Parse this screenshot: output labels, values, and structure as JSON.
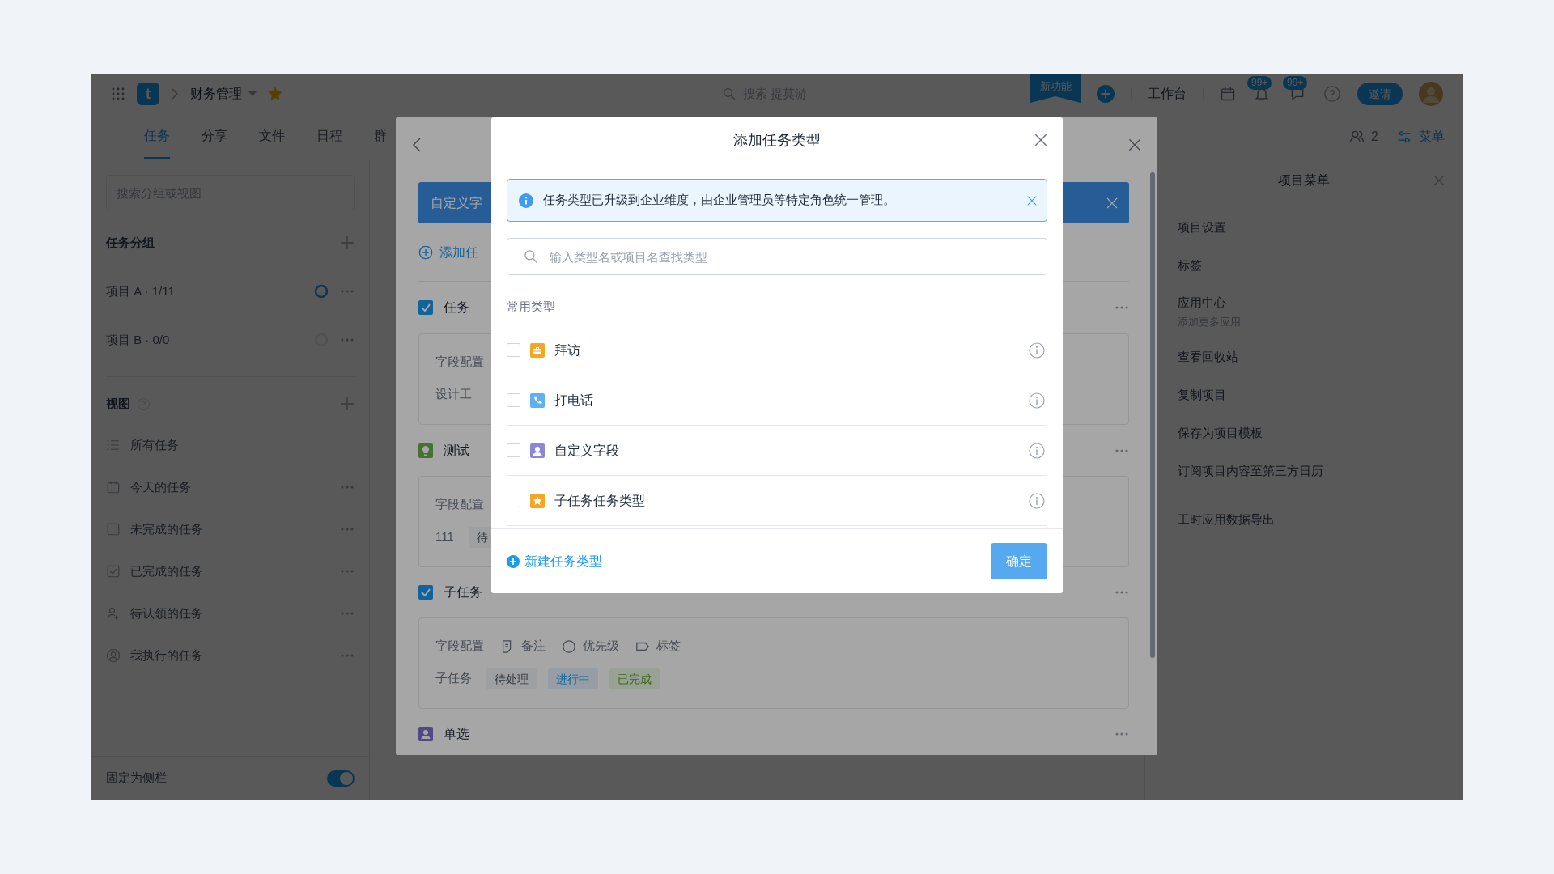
{
  "top_bar": {
    "logo": "t",
    "project": "财务管理",
    "starred": true,
    "search_placeholder": "搜索 提莫游",
    "new_feature": "新功能",
    "workbench": "工作台",
    "notifications": "99+",
    "messages": "99+",
    "invite": "邀请"
  },
  "tabs": [
    {
      "label": "任务",
      "selected": true
    },
    {
      "label": "分享",
      "selected": false
    },
    {
      "label": "文件",
      "selected": false
    },
    {
      "label": "日程",
      "selected": false
    },
    {
      "label": "群",
      "selected": false
    }
  ],
  "members": "2",
  "menu_button": "菜单",
  "sidebar": {
    "search_placeholder": "搜索分组或视图",
    "groups_title": "任务分组",
    "groups": [
      {
        "label": "项目 A · 1/11",
        "kind": "progress"
      },
      {
        "label": "项目 B · 0/0",
        "kind": "empty"
      }
    ],
    "views_title": "视图",
    "views": [
      {
        "label": "所有任务",
        "kind": "list",
        "more": false
      },
      {
        "label": "今天的任务",
        "kind": "calendar",
        "more": true
      },
      {
        "label": "未完成的任务",
        "kind": "square",
        "more": true
      },
      {
        "label": "已完成的任务",
        "kind": "checked",
        "more": true
      },
      {
        "label": "待认领的任务",
        "kind": "user-plus",
        "more": true
      },
      {
        "label": "我执行的任务",
        "kind": "user-circle",
        "more": true
      }
    ],
    "pin_label": "固定为侧栏",
    "pinned": true
  },
  "project_menu": {
    "title": "项目菜单",
    "items": [
      {
        "label": "项目设置"
      },
      {
        "label": "标签"
      },
      {
        "label": "应用中心",
        "note": "添加更多应用"
      },
      {
        "label": "查看回收站"
      },
      {
        "label": "复制项目"
      },
      {
        "label": "保存为项目模板"
      },
      {
        "label": "订阅项目内容至第三方日历"
      },
      {
        "label": "工时应用数据导出"
      }
    ]
  },
  "panel": {
    "banner": "自定义字",
    "add_label": "添加任",
    "types": [
      {
        "label": "任务",
        "kind": "checkbox",
        "card": {
          "field_label": "字段配置",
          "status_label": "设计工"
        }
      },
      {
        "label": "测试",
        "kind": "bulb",
        "card": {
          "field_label": "字段配置",
          "status_label": "111",
          "statuses": [
            {
              "label": "待",
              "kind": "todo"
            }
          ]
        }
      },
      {
        "label": "子任务",
        "kind": "checkbox",
        "card": {
          "field_label": "字段配置",
          "fields": [
            {
              "label": "备注",
              "kind": "note"
            },
            {
              "label": "优先级",
              "kind": "circle"
            },
            {
              "label": "标签",
              "kind": "tag"
            }
          ],
          "status_label": "子任务",
          "statuses": [
            {
              "label": "待处理",
              "kind": "todo"
            },
            {
              "label": "进行中",
              "kind": "doing"
            },
            {
              "label": "已完成",
              "kind": "done"
            }
          ]
        }
      },
      {
        "label": "单选",
        "kind": "person"
      }
    ]
  },
  "dialog": {
    "title": "添加任务类型",
    "notice": "任务类型已升级到企业维度，由企业管理员等特定角色统一管理。",
    "search_placeholder": "输入类型名或项目名查找类型",
    "section": "常用类型",
    "types": [
      {
        "label": "拜访",
        "kind": "briefcase",
        "color": "#f5a623",
        "checked": false
      },
      {
        "label": "打电话",
        "kind": "phone",
        "color": "#5fb0f2",
        "checked": false
      },
      {
        "label": "自定义字段",
        "kind": "person",
        "color": "#8c86d9",
        "checked": false
      },
      {
        "label": "子任务任务类型",
        "kind": "star",
        "color": "#f5a623",
        "checked": false
      }
    ],
    "new_type": "新建任务类型",
    "confirm": "确定"
  }
}
